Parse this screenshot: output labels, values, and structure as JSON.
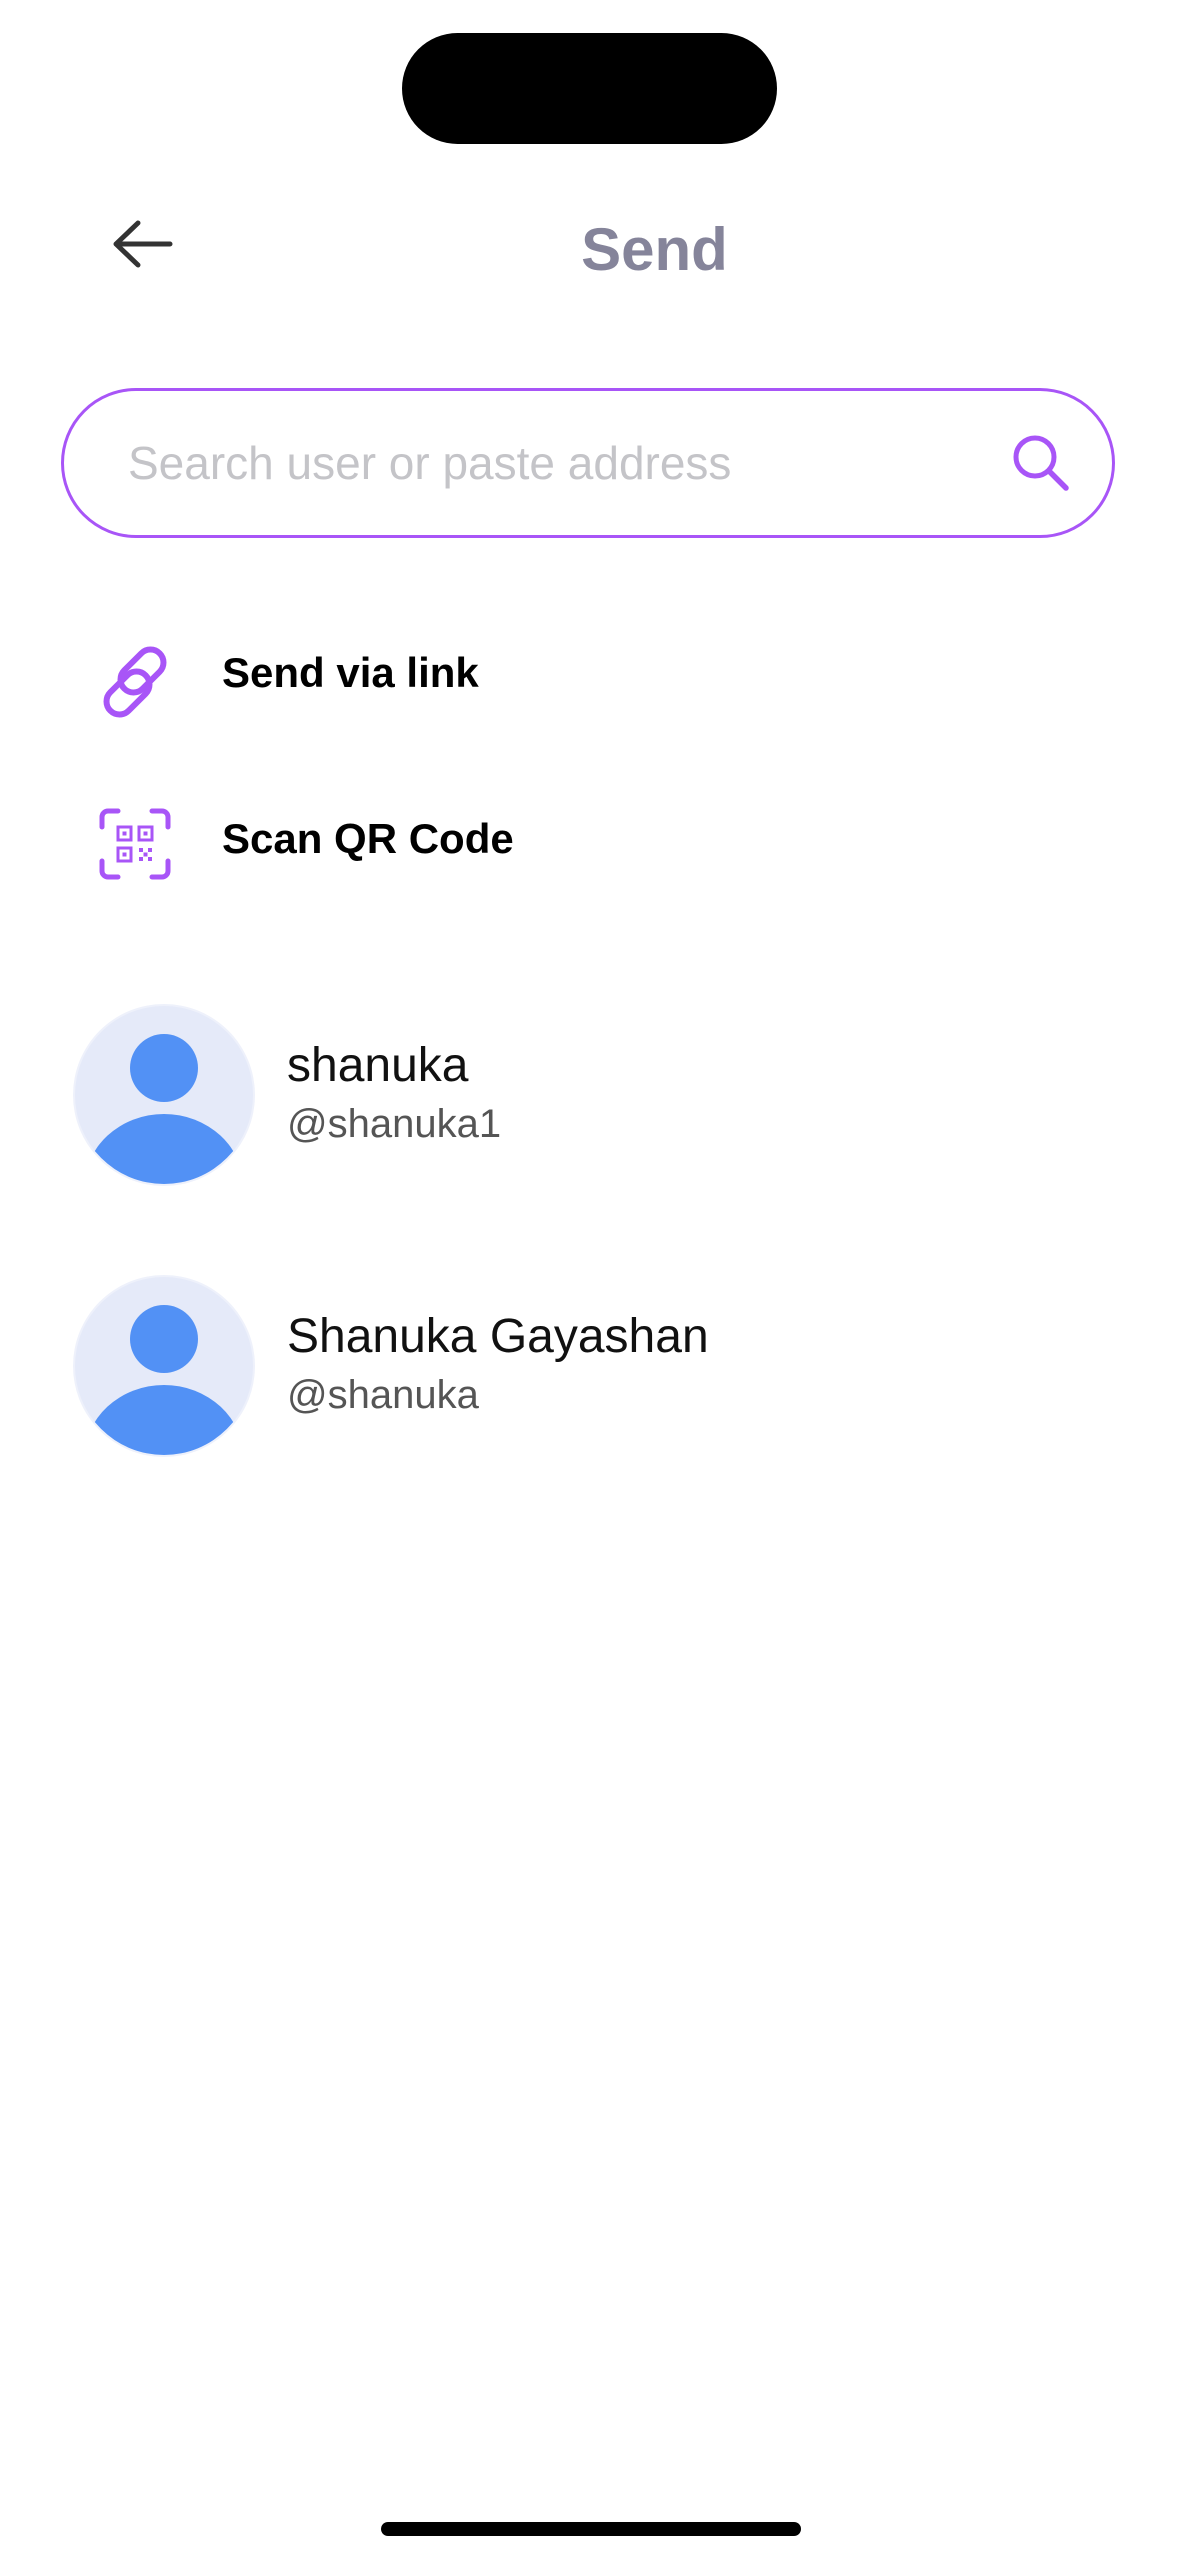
{
  "header": {
    "title": "Send",
    "back_icon": "arrow-left-icon"
  },
  "search": {
    "placeholder": "Search user or paste address",
    "value": "",
    "icon": "search-icon"
  },
  "actions": [
    {
      "label": "Send via link",
      "icon": "link-icon"
    },
    {
      "label": "Scan QR Code",
      "icon": "qr-code-icon"
    }
  ],
  "contacts": [
    {
      "name": "shanuka",
      "handle": "@shanuka1"
    },
    {
      "name": "Shanuka Gayashan",
      "handle": "@shanuka"
    }
  ],
  "colors": {
    "accent": "#a855f7",
    "title": "#85849a",
    "avatar_bg": "#e5eaf9",
    "avatar_fg": "#5291f5"
  }
}
